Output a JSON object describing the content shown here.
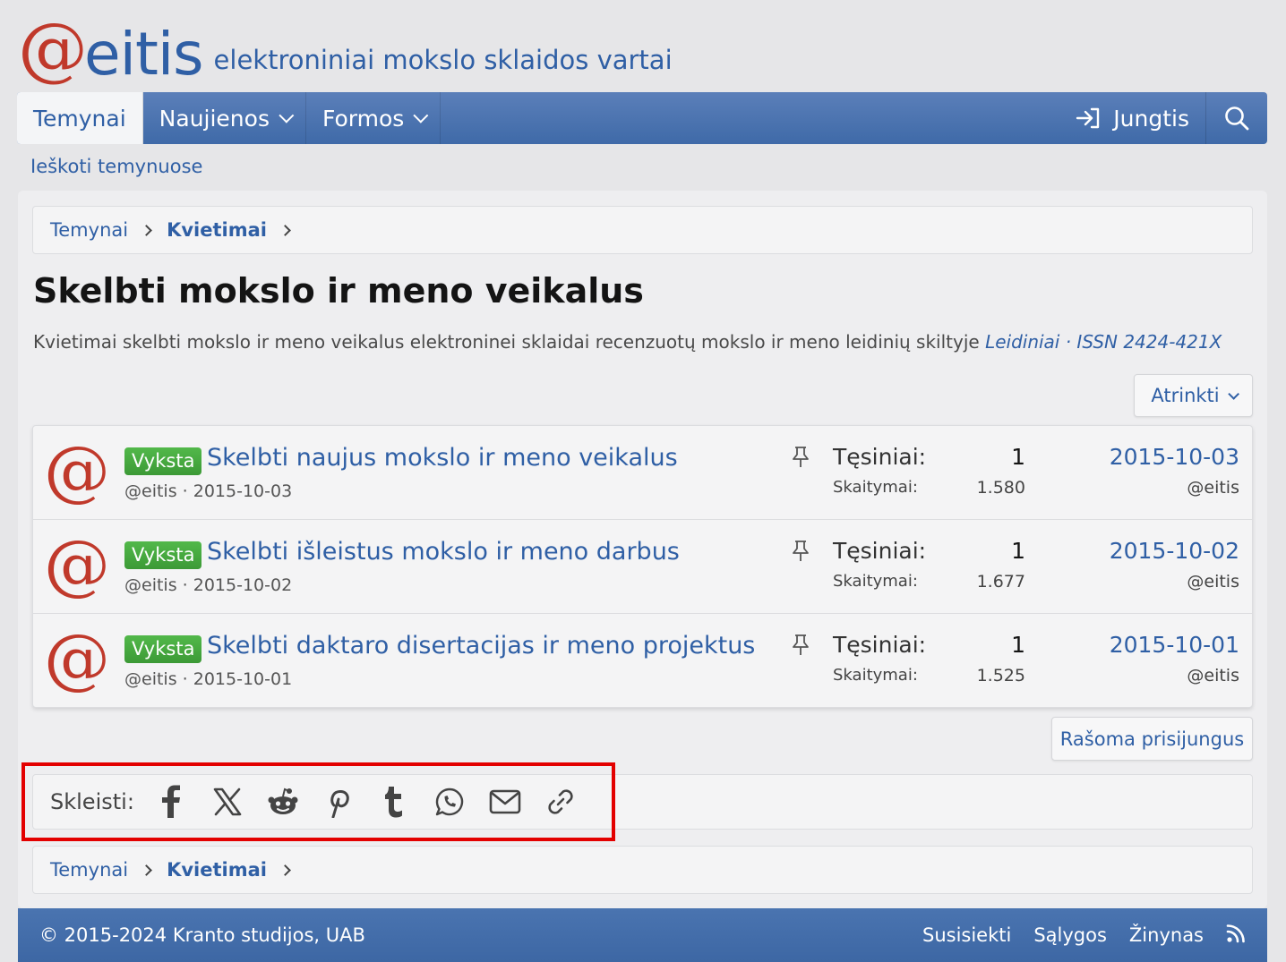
{
  "site": {
    "logo_at": "@",
    "logo_word": "eitis",
    "tagline": "elektroniniai mokslo sklaidos vartai"
  },
  "nav": {
    "tabs": [
      {
        "label": "Temynai"
      },
      {
        "label": "Naujienos"
      },
      {
        "label": "Formos"
      }
    ],
    "login_label": "Jungtis"
  },
  "search_forums_label": "Ieškoti temynuose",
  "breadcrumb": [
    "Temynai",
    "Kvietimai"
  ],
  "page": {
    "title": "Skelbti mokslo ir meno veikalus",
    "description": "Kvietimai skelbti mokslo ir meno veikalus elektroninei sklaidai recenzuotų mokslo ir meno leidinių skiltyje ",
    "description_link": "Leidiniai · ISSN 2424-421X",
    "filter_label": "Atrinkti",
    "post_button": "Rašoma prisijungus"
  },
  "thread_labels": {
    "replies": "Tęsiniai:",
    "views": "Skaitymai:"
  },
  "threads": [
    {
      "prefix": "Vyksta",
      "title": "Skelbti naujus mokslo ir meno veikalus",
      "author": "@eitis",
      "date": "2015-10-03",
      "replies": "1",
      "views": "1.580",
      "last_date": "2015-10-03",
      "last_user": "@eitis"
    },
    {
      "prefix": "Vyksta",
      "title": "Skelbti išleistus mokslo ir meno darbus",
      "author": "@eitis",
      "date": "2015-10-02",
      "replies": "1",
      "views": "1.677",
      "last_date": "2015-10-02",
      "last_user": "@eitis"
    },
    {
      "prefix": "Vyksta",
      "title": "Skelbti daktaro disertacijas ir meno projektus",
      "author": "@eitis",
      "date": "2015-10-01",
      "replies": "1",
      "views": "1.525",
      "last_date": "2015-10-01",
      "last_user": "@eitis"
    }
  ],
  "share": {
    "label": "Skleisti:",
    "icons": [
      "facebook-icon",
      "x-icon",
      "reddit-icon",
      "pinterest-icon",
      "tumblr-icon",
      "whatsapp-icon",
      "email-icon",
      "link-icon"
    ]
  },
  "footer": {
    "copyright": "© 2015-2024 Kranto studijos, UAB",
    "links": [
      "Susisiekti",
      "Sąlygos",
      "Žinynas"
    ]
  },
  "colors": {
    "accent": "#2f5fa5",
    "logo_red": "#c0392b",
    "prefix_green": "#46a83f",
    "highlight_red": "#e30000"
  }
}
